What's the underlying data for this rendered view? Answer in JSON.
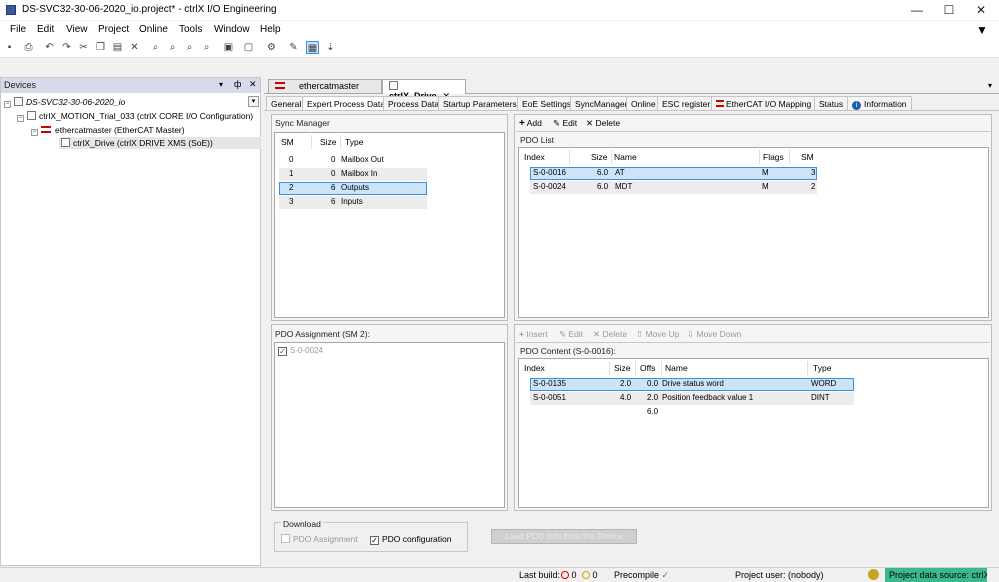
{
  "window": {
    "title": "DS-SVC32-30-06-2020_io.project* - ctrlX I/O Engineering",
    "minimize": "—",
    "maximize": "☐",
    "close": "✕"
  },
  "menu": [
    "File",
    "Edit",
    "View",
    "Project",
    "Online",
    "Tools",
    "Window",
    "Help"
  ],
  "devices": {
    "title": "Devices",
    "tree": [
      {
        "label": "DS-SVC32-30-06-2020_io"
      },
      {
        "label": "ctrlX_MOTION_Trial_033 (ctrlX CORE I/O Configuration)"
      },
      {
        "label": "ethercatmaster (EtherCAT Master)"
      },
      {
        "label": "ctrlX_Drive (ctrlX DRIVE XMS (SoE))"
      }
    ]
  },
  "doc_tabs": [
    "ethercatmaster",
    "ctrlX_Drive"
  ],
  "sub_tabs": [
    "General",
    "Expert Process Data",
    "Process Data",
    "Startup Parameters",
    "EoE Settings",
    "SyncManager",
    "Online",
    "ESC register",
    "EtherCAT I/O Mapping",
    "Status",
    "Information"
  ],
  "sync_manager": {
    "title": "Sync Manager",
    "headers": [
      "SM",
      "Size",
      "Type"
    ],
    "rows": [
      {
        "sm": "0",
        "size": "0",
        "type": "Mailbox Out"
      },
      {
        "sm": "1",
        "size": "0",
        "type": "Mailbox In"
      },
      {
        "sm": "2",
        "size": "6",
        "type": "Outputs"
      },
      {
        "sm": "3",
        "size": "6",
        "type": "Inputs"
      }
    ]
  },
  "pdo_list": {
    "actions": [
      "Add",
      "Edit",
      "Delete"
    ],
    "title": "PDO List",
    "headers": [
      "Index",
      "Size",
      "Name",
      "Flags",
      "SM"
    ],
    "rows": [
      {
        "index": "S-0-0016",
        "size": "6.0",
        "name": "AT",
        "flags": "M",
        "sm": "3"
      },
      {
        "index": "S-0-0024",
        "size": "6.0",
        "name": "MDT",
        "flags": "M",
        "sm": "2"
      }
    ]
  },
  "pdo_assignment": {
    "title": "PDO Assignment (SM 2):",
    "items": [
      "S-0-0024"
    ]
  },
  "pdo_content": {
    "actions": [
      "Insert",
      "Edit",
      "Delete",
      "Move Up",
      "Move Down"
    ],
    "title": "PDO Content (S-0-0016):",
    "headers": [
      "Index",
      "Size",
      "Offs",
      "Name",
      "Type"
    ],
    "rows": [
      {
        "index": "S-0-0135",
        "size": "2.0",
        "offs": "0.0",
        "name": "Drive status word",
        "type": "WORD"
      },
      {
        "index": "S-0-0051",
        "size": "4.0",
        "offs": "2.0",
        "name": "Position feedback value 1",
        "type": "DINT"
      },
      {
        "index": "",
        "size": "",
        "offs": "6.0",
        "name": "",
        "type": ""
      }
    ]
  },
  "download": {
    "title": "Download",
    "pdo_assignment": "PDO Assignment",
    "pdo_configuration": "PDO configuration",
    "load_button": "Load PDO Info from the Device"
  },
  "status": {
    "last_build": "Last build:",
    "errors": "0",
    "warnings": "0",
    "precompile": "Precompile",
    "project_user": "Project user: (nobody)",
    "data_source": "Project data source: ctrlX"
  },
  "colors": {
    "accent": "#3d8ee0",
    "selection": "#cce4f7",
    "status_green": "#3bb98e"
  }
}
